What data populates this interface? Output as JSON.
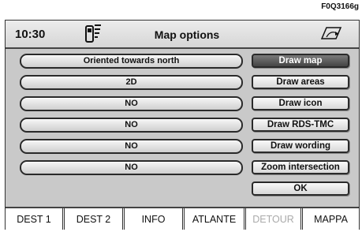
{
  "figure_code": "F0Q3166g",
  "header": {
    "time": "10:30",
    "title": "Map options"
  },
  "options": [
    {
      "value": "Oriented towards north"
    },
    {
      "value": "2D"
    },
    {
      "value": "NO"
    },
    {
      "value": "NO"
    },
    {
      "value": "NO"
    },
    {
      "value": "NO"
    }
  ],
  "buttons": [
    {
      "label": "Draw map",
      "active": true
    },
    {
      "label": "Draw areas",
      "active": false
    },
    {
      "label": "Draw icon",
      "active": false
    },
    {
      "label": "Draw RDS-TMC",
      "active": false
    },
    {
      "label": "Draw wording",
      "active": false
    },
    {
      "label": "Zoom intersection",
      "active": false
    },
    {
      "label": "OK",
      "active": false
    }
  ],
  "tabs": [
    {
      "label": "DEST 1",
      "enabled": true
    },
    {
      "label": "DEST 2",
      "enabled": true
    },
    {
      "label": "INFO",
      "enabled": true
    },
    {
      "label": "ATLANTE",
      "enabled": true
    },
    {
      "label": "DETOUR",
      "enabled": false
    },
    {
      "label": "MAPPA",
      "enabled": true
    }
  ],
  "colors": {
    "panel_background": "#c9c9c9",
    "active_button": "#454545",
    "disabled_tab_text": "#aaaaaa"
  },
  "icons": {
    "header_left": "phone-signal-icon",
    "header_right": "map-navigation-icon"
  }
}
